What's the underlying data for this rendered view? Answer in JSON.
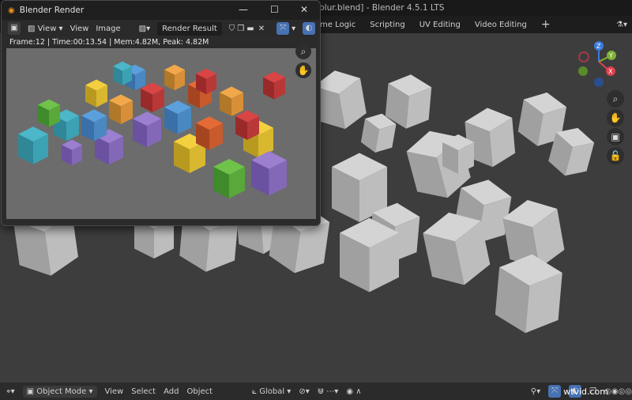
{
  "app_title": "blur.blend] - Blender 4.5.1 LTS",
  "workspace_tabs": [
    "me Logic",
    "Scripting",
    "UV Editing",
    "Video Editing",
    "+"
  ],
  "render_window": {
    "title": "Blender Render",
    "toolbar": {
      "view_dropdown": "View",
      "menu_view": "View",
      "menu_image": "Image",
      "image_name": "Render Result"
    },
    "info": "Frame:12 | Time:00:13.54 | Mem:4.82M, Peak: 4.82M"
  },
  "bottom_bar": {
    "mode": "Object Mode",
    "menus": [
      "View",
      "Select",
      "Add",
      "Object"
    ],
    "orientation": "Global",
    "watermark": "wtvid.com"
  },
  "gizmo": {
    "z": "Z",
    "y": "Y",
    "x": "X"
  },
  "colors": {
    "accent": "#4772b3",
    "x_axis": "#e0414f",
    "y_axis": "#7fb234",
    "z_axis": "#3a7be0"
  }
}
